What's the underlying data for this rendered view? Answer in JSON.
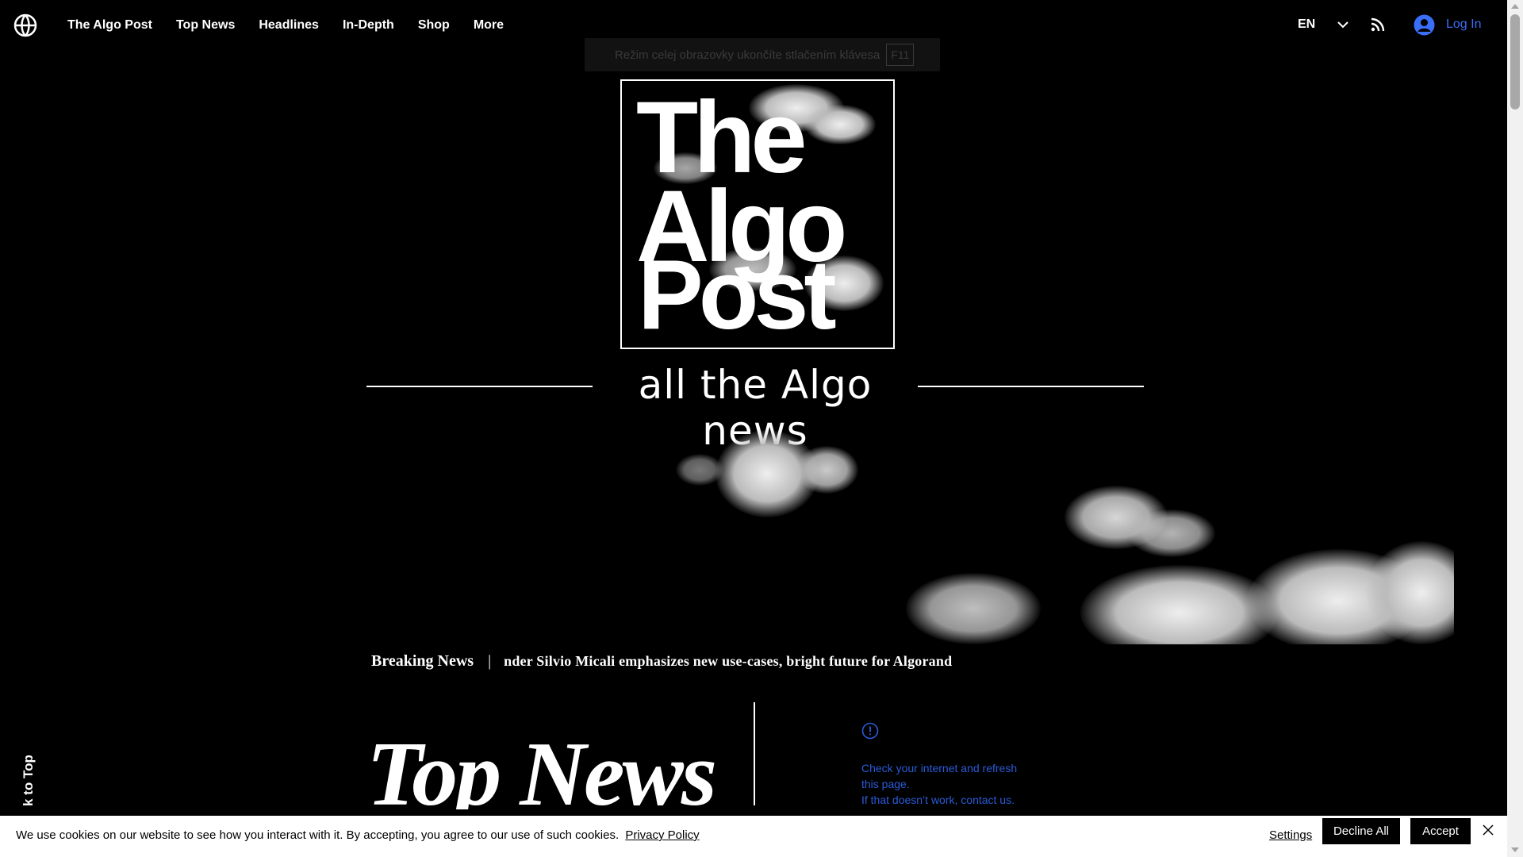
{
  "nav": {
    "items": [
      "The Algo Post",
      "Top News",
      "Headlines",
      "In-Depth",
      "Shop",
      "More"
    ],
    "language": "EN",
    "login_label": "Log In"
  },
  "fullscreen_notice": {
    "text": "Režim celej obrazovky ukončíte stlačením klávesa",
    "key": "F11"
  },
  "masthead": {
    "logo_words": [
      "The",
      "Algo",
      "Post"
    ],
    "tagline": "all the Algo news"
  },
  "breaking_news": {
    "title": "Breaking News",
    "separator": "|",
    "text": "nder Silvio Micali emphasizes new use-cases, bright future for Algorand"
  },
  "top_news": {
    "heading": "Top News"
  },
  "error_notice": {
    "line1": "Check your internet and refresh this page.",
    "line2": "If that doesn’t work, contact us."
  },
  "back_to_top": "k to Top",
  "cookie_banner": {
    "text": "We use cookies on our website to see how you interact with it. By accepting, you agree to our use of such cookies.",
    "privacy_link": "Privacy Policy",
    "settings_label": "Settings",
    "decline_label": "Decline All",
    "accept_label": "Accept"
  },
  "colors": {
    "background": "#000000",
    "text": "#ffffff",
    "login_accent": "#3b6ef6",
    "error_text": "#2a5bd7"
  },
  "icons": [
    "globe-logo-icon",
    "chevron-down-icon",
    "rss-icon",
    "user-avatar-icon",
    "alert-circle-icon",
    "close-icon"
  ]
}
